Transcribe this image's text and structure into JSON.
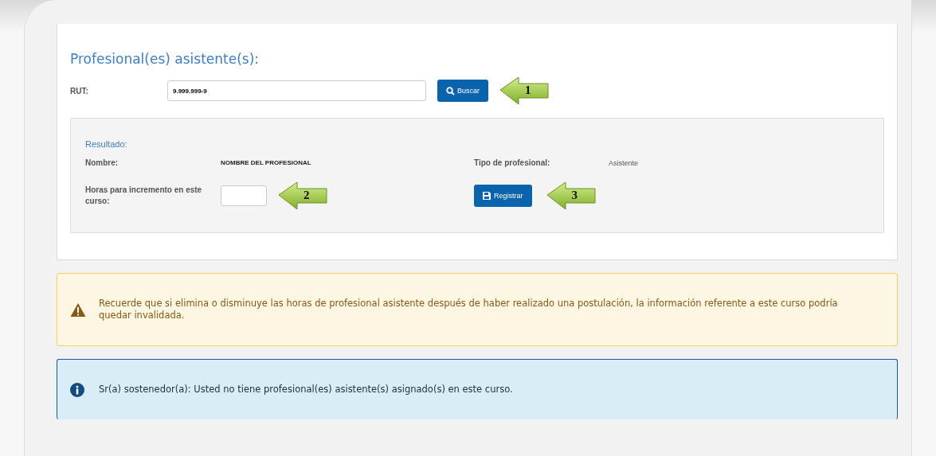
{
  "section_title": "Profesional(es) asistente(s):",
  "rut": {
    "label": "RUT:",
    "value": "9.999.999-9",
    "button": "Buscar",
    "callout": "1"
  },
  "result": {
    "title": "Resultado:",
    "name_label": "Nombre:",
    "name_value": "NOMBRE DEL PROFESIONAL",
    "type_label": "Tipo de profesional:",
    "type_value": "Asistente",
    "hours_label": "Horas para incremento en este curso:",
    "hours_callout": "2",
    "register_button": "Registrar",
    "register_callout": "3"
  },
  "alerts": [
    {
      "kind": "warning",
      "text": "Recuerde que si elimina o disminuye las horas de profesional asistente después de haber realizado una postulación, la información referente a este curso podría quedar invalidada."
    },
    {
      "kind": "info",
      "text": "Sr(a) sostenedor(a): Usted no tiene profesional(es) asistente(s) asignado(s) en este curso."
    }
  ]
}
